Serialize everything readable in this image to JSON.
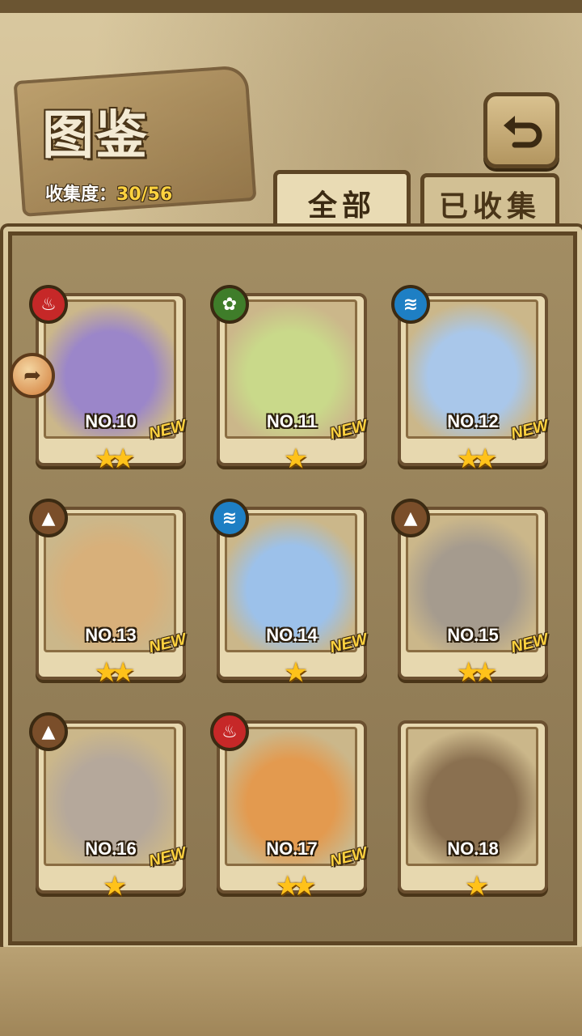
{
  "header": {
    "title": "图鉴",
    "collection_label": "收集度：",
    "collection_value": "30/56"
  },
  "tabs": [
    {
      "label": "全部",
      "active": true
    },
    {
      "label": "已收集",
      "active": false
    }
  ],
  "cards": [
    {
      "number": "NO.10",
      "element": "fire-icon",
      "stars": "★★",
      "new": "NEW",
      "art": "#9b86c9"
    },
    {
      "number": "NO.11",
      "element": "grass-icon",
      "stars": "★",
      "new": "NEW",
      "art": "#c9d98a"
    },
    {
      "number": "NO.12",
      "element": "water-icon",
      "stars": "★★",
      "new": "NEW",
      "art": "#a9c7ea"
    },
    {
      "number": "NO.13",
      "element": "earth-icon",
      "stars": "★★",
      "new": "NEW",
      "art": "#d8b07a"
    },
    {
      "number": "NO.14",
      "element": "water-icon",
      "stars": "★",
      "new": "NEW",
      "art": "#9cc1ea"
    },
    {
      "number": "NO.15",
      "element": "earth-icon",
      "stars": "★★",
      "new": "NEW",
      "art": "#a59b8e"
    },
    {
      "number": "NO.16",
      "element": "earth-icon",
      "stars": "★",
      "new": "NEW",
      "art": "#b5a89b"
    },
    {
      "number": "NO.17",
      "element": "fire-icon",
      "stars": "★★",
      "new": "NEW",
      "art": "#e39a4f"
    },
    {
      "number": "NO.18",
      "element": "",
      "stars": "★",
      "new": "",
      "art": "#8a7050"
    }
  ]
}
